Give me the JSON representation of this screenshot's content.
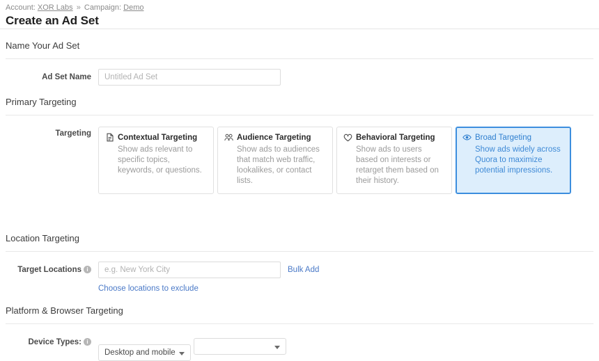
{
  "header": {
    "breadcrumb": {
      "account_label": "Account:",
      "account_value": "XOR Labs",
      "separator": "»",
      "campaign_label": "Campaign:",
      "campaign_value": "Demo"
    },
    "title": "Create an Ad Set"
  },
  "sections": {
    "name": {
      "title": "Name Your Ad Set",
      "ad_set_name_label": "Ad Set Name",
      "ad_set_name_value": "",
      "ad_set_name_placeholder": "Untitled Ad Set"
    },
    "primary_targeting": {
      "title": "Primary Targeting",
      "targeting_label": "Targeting",
      "cards": [
        {
          "icon": "document-icon",
          "title": "Contextual Targeting",
          "description": "Show ads relevant to specific topics, keywords, or questions.",
          "selected": false
        },
        {
          "icon": "people-icon",
          "title": "Audience Targeting",
          "description": "Show ads to audiences that match web traffic, lookalikes, or contact lists.",
          "selected": false
        },
        {
          "icon": "heart-icon",
          "title": "Behavioral Targeting",
          "description": "Show ads to users based on interests or retarget them based on their history.",
          "selected": false
        },
        {
          "icon": "eye-icon",
          "title": "Broad Targeting",
          "description": "Show ads widely across Quora to maximize potential impressions.",
          "selected": true
        }
      ]
    },
    "location_targeting": {
      "title": "Location Targeting",
      "target_locations_label": "Target Locations",
      "target_locations_value": "",
      "target_locations_placeholder": "e.g. New York City",
      "bulk_add_label": "Bulk Add",
      "exclude_link_label": "Choose locations to exclude",
      "info_icon": "i"
    },
    "platform_targeting": {
      "title": "Platform & Browser Targeting",
      "device_types_label": "Device Types:",
      "device_types_value": "Desktop and mobile",
      "info_icon": "i"
    }
  },
  "colors": {
    "accent_blue": "#4a79c7",
    "selected_border": "#3c8ede",
    "selected_bg": "#ddeefc",
    "selected_text": "#2f7fcf"
  }
}
